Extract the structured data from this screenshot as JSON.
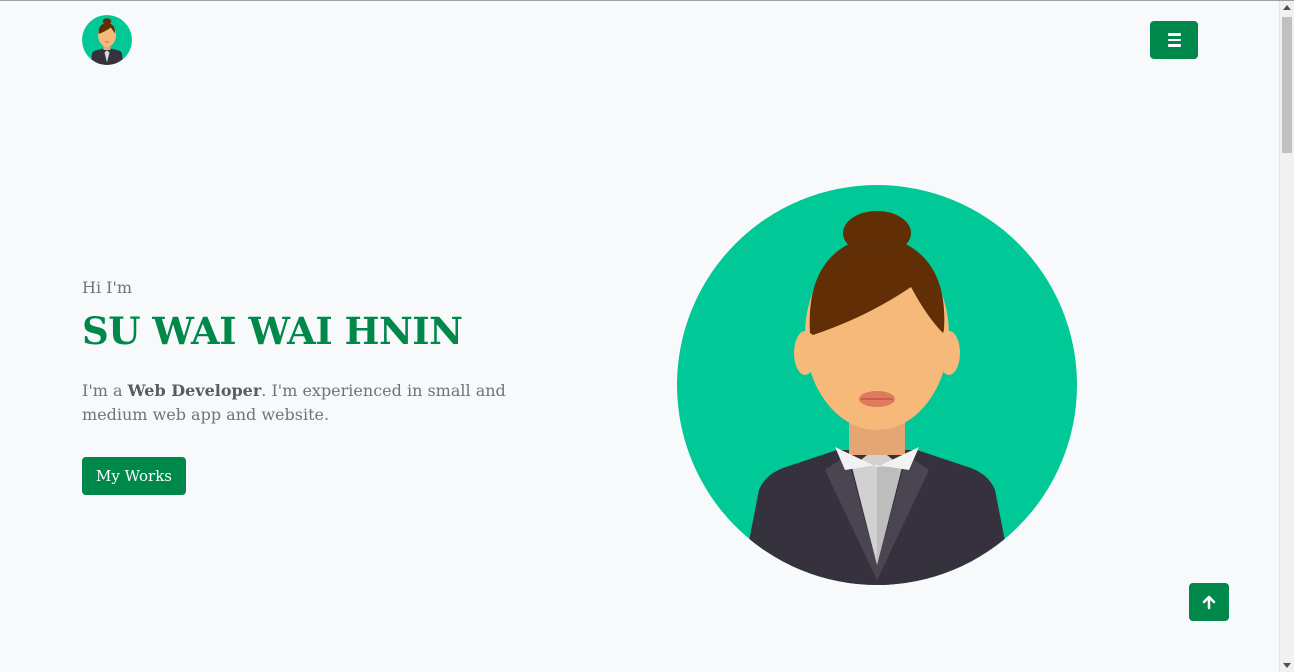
{
  "header": {
    "logo_icon": "avatar-woman-icon",
    "menu_icon": "hamburger-menu-icon"
  },
  "hero": {
    "greeting": "Hi I'm",
    "name": "SU WAI WAI HNIN",
    "intro_prefix": "I'm a ",
    "intro_role": "Web Developer",
    "intro_suffix": ". I'm experienced in small and medium web app and website.",
    "cta_label": "My Works",
    "portrait_icon": "woman-avatar-illustration"
  },
  "back_to_top_icon": "arrow-up-icon",
  "colors": {
    "accent": "#00884b",
    "avatar_bg": "#00c896",
    "background": "#f8f9fb",
    "text_muted": "#6c757d"
  }
}
